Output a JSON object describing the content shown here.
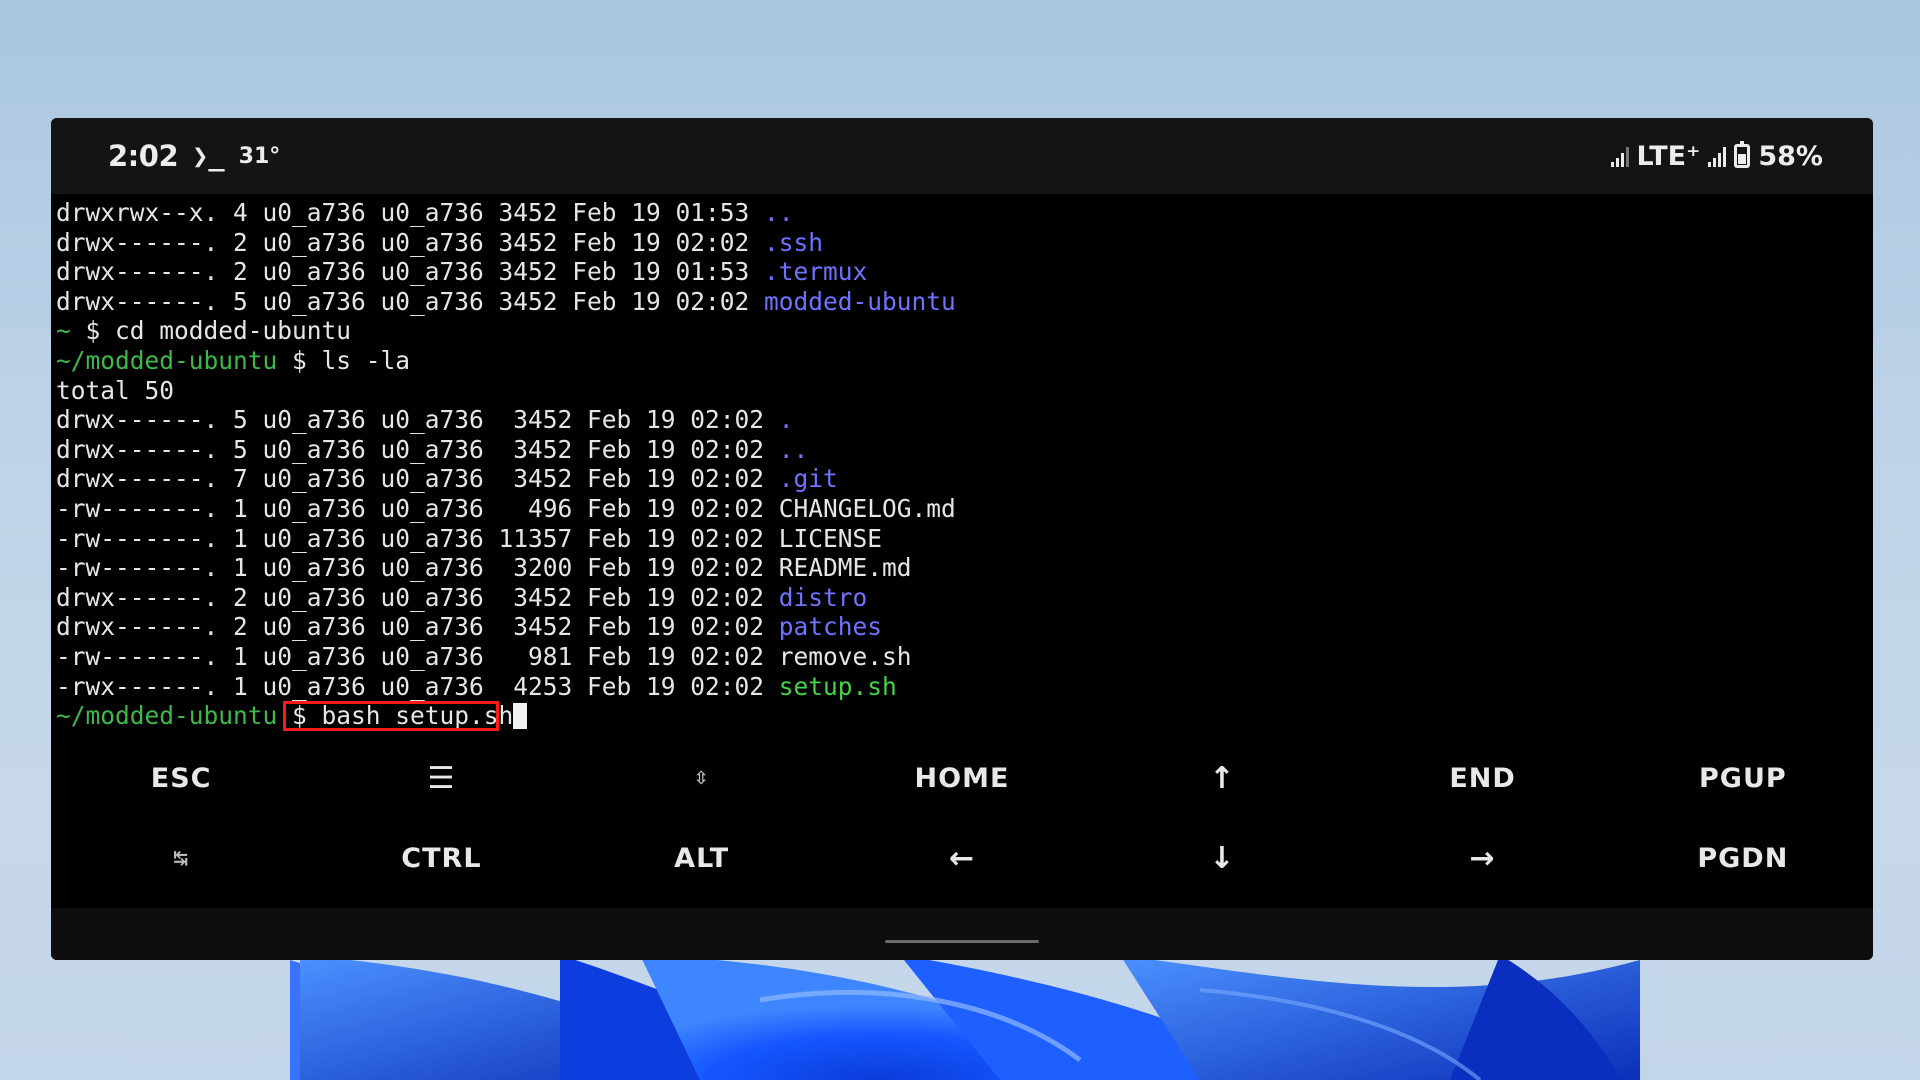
{
  "status_bar": {
    "time": "2:02",
    "terminal_icon": "❯_",
    "temperature": "31°",
    "network": "LTE⁺",
    "battery": "58%",
    "battery_level": 0.58
  },
  "terminal": {
    "lines": [
      {
        "text": "drwxrwx--x. 4 u0_a736 u0_a736 3452 Feb 19 01:53 ",
        "name": "..",
        "kind": "dir"
      },
      {
        "text": "drwx------. 2 u0_a736 u0_a736 3452 Feb 19 02:02 ",
        "name": ".ssh",
        "kind": "dir"
      },
      {
        "text": "drwx------. 2 u0_a736 u0_a736 3452 Feb 19 01:53 ",
        "name": ".termux",
        "kind": "dir"
      },
      {
        "text": "drwx------. 5 u0_a736 u0_a736 3452 Feb 19 02:02 ",
        "name": "modded-ubuntu",
        "kind": "dir"
      },
      {
        "prompt": "~",
        "command": " $ cd modded-ubuntu"
      },
      {
        "prompt": "~/modded-ubuntu",
        "command": " $ ls -la"
      },
      {
        "text": "total 50",
        "name": "",
        "kind": "plain"
      },
      {
        "text": "drwx------. 5 u0_a736 u0_a736  3452 Feb 19 02:02 ",
        "name": ".",
        "kind": "dir"
      },
      {
        "text": "drwx------. 5 u0_a736 u0_a736  3452 Feb 19 02:02 ",
        "name": "..",
        "kind": "dir"
      },
      {
        "text": "drwx------. 7 u0_a736 u0_a736  3452 Feb 19 02:02 ",
        "name": ".git",
        "kind": "dir"
      },
      {
        "text": "-rw-------. 1 u0_a736 u0_a736   496 Feb 19 02:02 ",
        "name": "CHANGELOG.md",
        "kind": "plain"
      },
      {
        "text": "-rw-------. 1 u0_a736 u0_a736 11357 Feb 19 02:02 ",
        "name": "LICENSE",
        "kind": "plain"
      },
      {
        "text": "-rw-------. 1 u0_a736 u0_a736  3200 Feb 19 02:02 ",
        "name": "README.md",
        "kind": "plain"
      },
      {
        "text": "drwx------. 2 u0_a736 u0_a736  3452 Feb 19 02:02 ",
        "name": "distro",
        "kind": "dir"
      },
      {
        "text": "drwx------. 2 u0_a736 u0_a736  3452 Feb 19 02:02 ",
        "name": "patches",
        "kind": "dir"
      },
      {
        "text": "-rw-------. 1 u0_a736 u0_a736   981 Feb 19 02:02 ",
        "name": "remove.sh",
        "kind": "plain"
      },
      {
        "text": "-rwx------. 1 u0_a736 u0_a736  4253 Feb 19 02:02 ",
        "name": "setup.sh",
        "kind": "exe"
      }
    ],
    "current_prompt": "~/modded-ubuntu",
    "current_input": " $ bash setup.sh"
  },
  "extra_keys": {
    "row1": [
      {
        "label": "ESC",
        "name": "esc-key"
      },
      {
        "label": "☰",
        "name": "menu-key"
      },
      {
        "label": "⇳",
        "name": "scroll-key"
      },
      {
        "label": "HOME",
        "name": "home-key"
      },
      {
        "label": "↑",
        "name": "arrow-up-key"
      },
      {
        "label": "END",
        "name": "end-key"
      },
      {
        "label": "PGUP",
        "name": "pgup-key"
      }
    ],
    "row2": [
      {
        "label": "↹",
        "name": "tab-key"
      },
      {
        "label": "CTRL",
        "name": "ctrl-key"
      },
      {
        "label": "ALT",
        "name": "alt-key"
      },
      {
        "label": "←",
        "name": "arrow-left-key"
      },
      {
        "label": "↓",
        "name": "arrow-down-key"
      },
      {
        "label": "→",
        "name": "arrow-right-key"
      },
      {
        "label": "PGDN",
        "name": "pgdn-key"
      }
    ]
  },
  "colors": {
    "directory": "#6f72ff",
    "executable": "#44d34a",
    "prompt": "#3fb84a",
    "highlight_box": "#ff1a1a"
  }
}
